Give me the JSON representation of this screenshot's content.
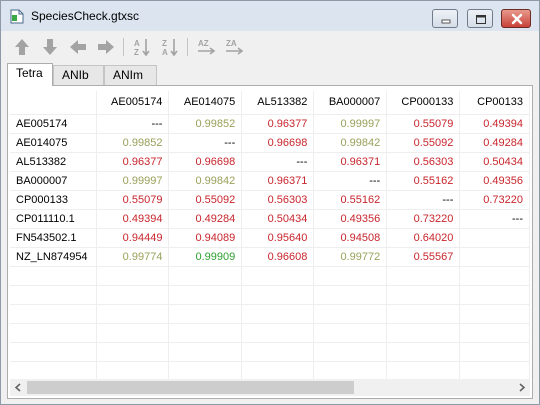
{
  "window": {
    "title": "SpeciesCheck.gtxsc"
  },
  "toolbar": {
    "buttons": [
      {
        "icon": "arrow-up-icon"
      },
      {
        "icon": "arrow-down-icon"
      },
      {
        "icon": "arrow-left-icon"
      },
      {
        "icon": "arrow-right-icon"
      },
      {
        "icon": "sort-az-down-icon",
        "text": "A Z"
      },
      {
        "icon": "sort-za-down-icon",
        "text": "Z A"
      },
      {
        "icon": "sort-az-right-icon",
        "text": "AZ"
      },
      {
        "icon": "sort-za-right-icon",
        "text": "ZA"
      }
    ]
  },
  "tabs": [
    {
      "label": "Tetra",
      "active": true
    },
    {
      "label": "ANIb",
      "active": false
    },
    {
      "label": "ANIm",
      "active": false
    }
  ],
  "colors": {
    "red": "#c8252c",
    "olive": "#9aa05a",
    "green": "#2ea02e",
    "dash": "#000000"
  },
  "grid": {
    "columns": [
      "AE005174",
      "AE014075",
      "AL513382",
      "BA000007",
      "CP000133",
      "CP00133"
    ],
    "rows": [
      {
        "name": "AE005174",
        "cells": [
          {
            "v": "---",
            "c": "dash"
          },
          {
            "v": "0.99852",
            "c": "olive"
          },
          {
            "v": "0.96377",
            "c": "red"
          },
          {
            "v": "0.99997",
            "c": "olive"
          },
          {
            "v": "0.55079",
            "c": "red"
          },
          {
            "v": "0.49394",
            "c": "red"
          }
        ]
      },
      {
        "name": "AE014075",
        "cells": [
          {
            "v": "0.99852",
            "c": "olive"
          },
          {
            "v": "---",
            "c": "dash"
          },
          {
            "v": "0.96698",
            "c": "red"
          },
          {
            "v": "0.99842",
            "c": "olive"
          },
          {
            "v": "0.55092",
            "c": "red"
          },
          {
            "v": "0.49284",
            "c": "red"
          }
        ]
      },
      {
        "name": "AL513382",
        "cells": [
          {
            "v": "0.96377",
            "c": "red"
          },
          {
            "v": "0.96698",
            "c": "red"
          },
          {
            "v": "---",
            "c": "dash"
          },
          {
            "v": "0.96371",
            "c": "red"
          },
          {
            "v": "0.56303",
            "c": "red"
          },
          {
            "v": "0.50434",
            "c": "red"
          }
        ]
      },
      {
        "name": "BA000007",
        "cells": [
          {
            "v": "0.99997",
            "c": "olive"
          },
          {
            "v": "0.99842",
            "c": "olive"
          },
          {
            "v": "0.96371",
            "c": "red"
          },
          {
            "v": "---",
            "c": "dash"
          },
          {
            "v": "0.55162",
            "c": "red"
          },
          {
            "v": "0.49356",
            "c": "red"
          }
        ]
      },
      {
        "name": "CP000133",
        "cells": [
          {
            "v": "0.55079",
            "c": "red"
          },
          {
            "v": "0.55092",
            "c": "red"
          },
          {
            "v": "0.56303",
            "c": "red"
          },
          {
            "v": "0.55162",
            "c": "red"
          },
          {
            "v": "---",
            "c": "dash"
          },
          {
            "v": "0.73220",
            "c": "red"
          }
        ]
      },
      {
        "name": "CP011110.1",
        "cells": [
          {
            "v": "0.49394",
            "c": "red"
          },
          {
            "v": "0.49284",
            "c": "red"
          },
          {
            "v": "0.50434",
            "c": "red"
          },
          {
            "v": "0.49356",
            "c": "red"
          },
          {
            "v": "0.73220",
            "c": "red"
          },
          {
            "v": "---",
            "c": "dash"
          }
        ]
      },
      {
        "name": "FN543502.1",
        "cells": [
          {
            "v": "0.94449",
            "c": "red"
          },
          {
            "v": "0.94089",
            "c": "red"
          },
          {
            "v": "0.95640",
            "c": "red"
          },
          {
            "v": "0.94508",
            "c": "red"
          },
          {
            "v": "0.64020",
            "c": "red"
          },
          {
            "v": "",
            "c": "red"
          }
        ]
      },
      {
        "name": "NZ_LN874954",
        "cells": [
          {
            "v": "0.99774",
            "c": "olive"
          },
          {
            "v": "0.99909",
            "c": "green"
          },
          {
            "v": "0.96608",
            "c": "red"
          },
          {
            "v": "0.99772",
            "c": "olive"
          },
          {
            "v": "0.55567",
            "c": "red"
          },
          {
            "v": "",
            "c": "red"
          }
        ]
      }
    ],
    "empty_rows": 7
  }
}
